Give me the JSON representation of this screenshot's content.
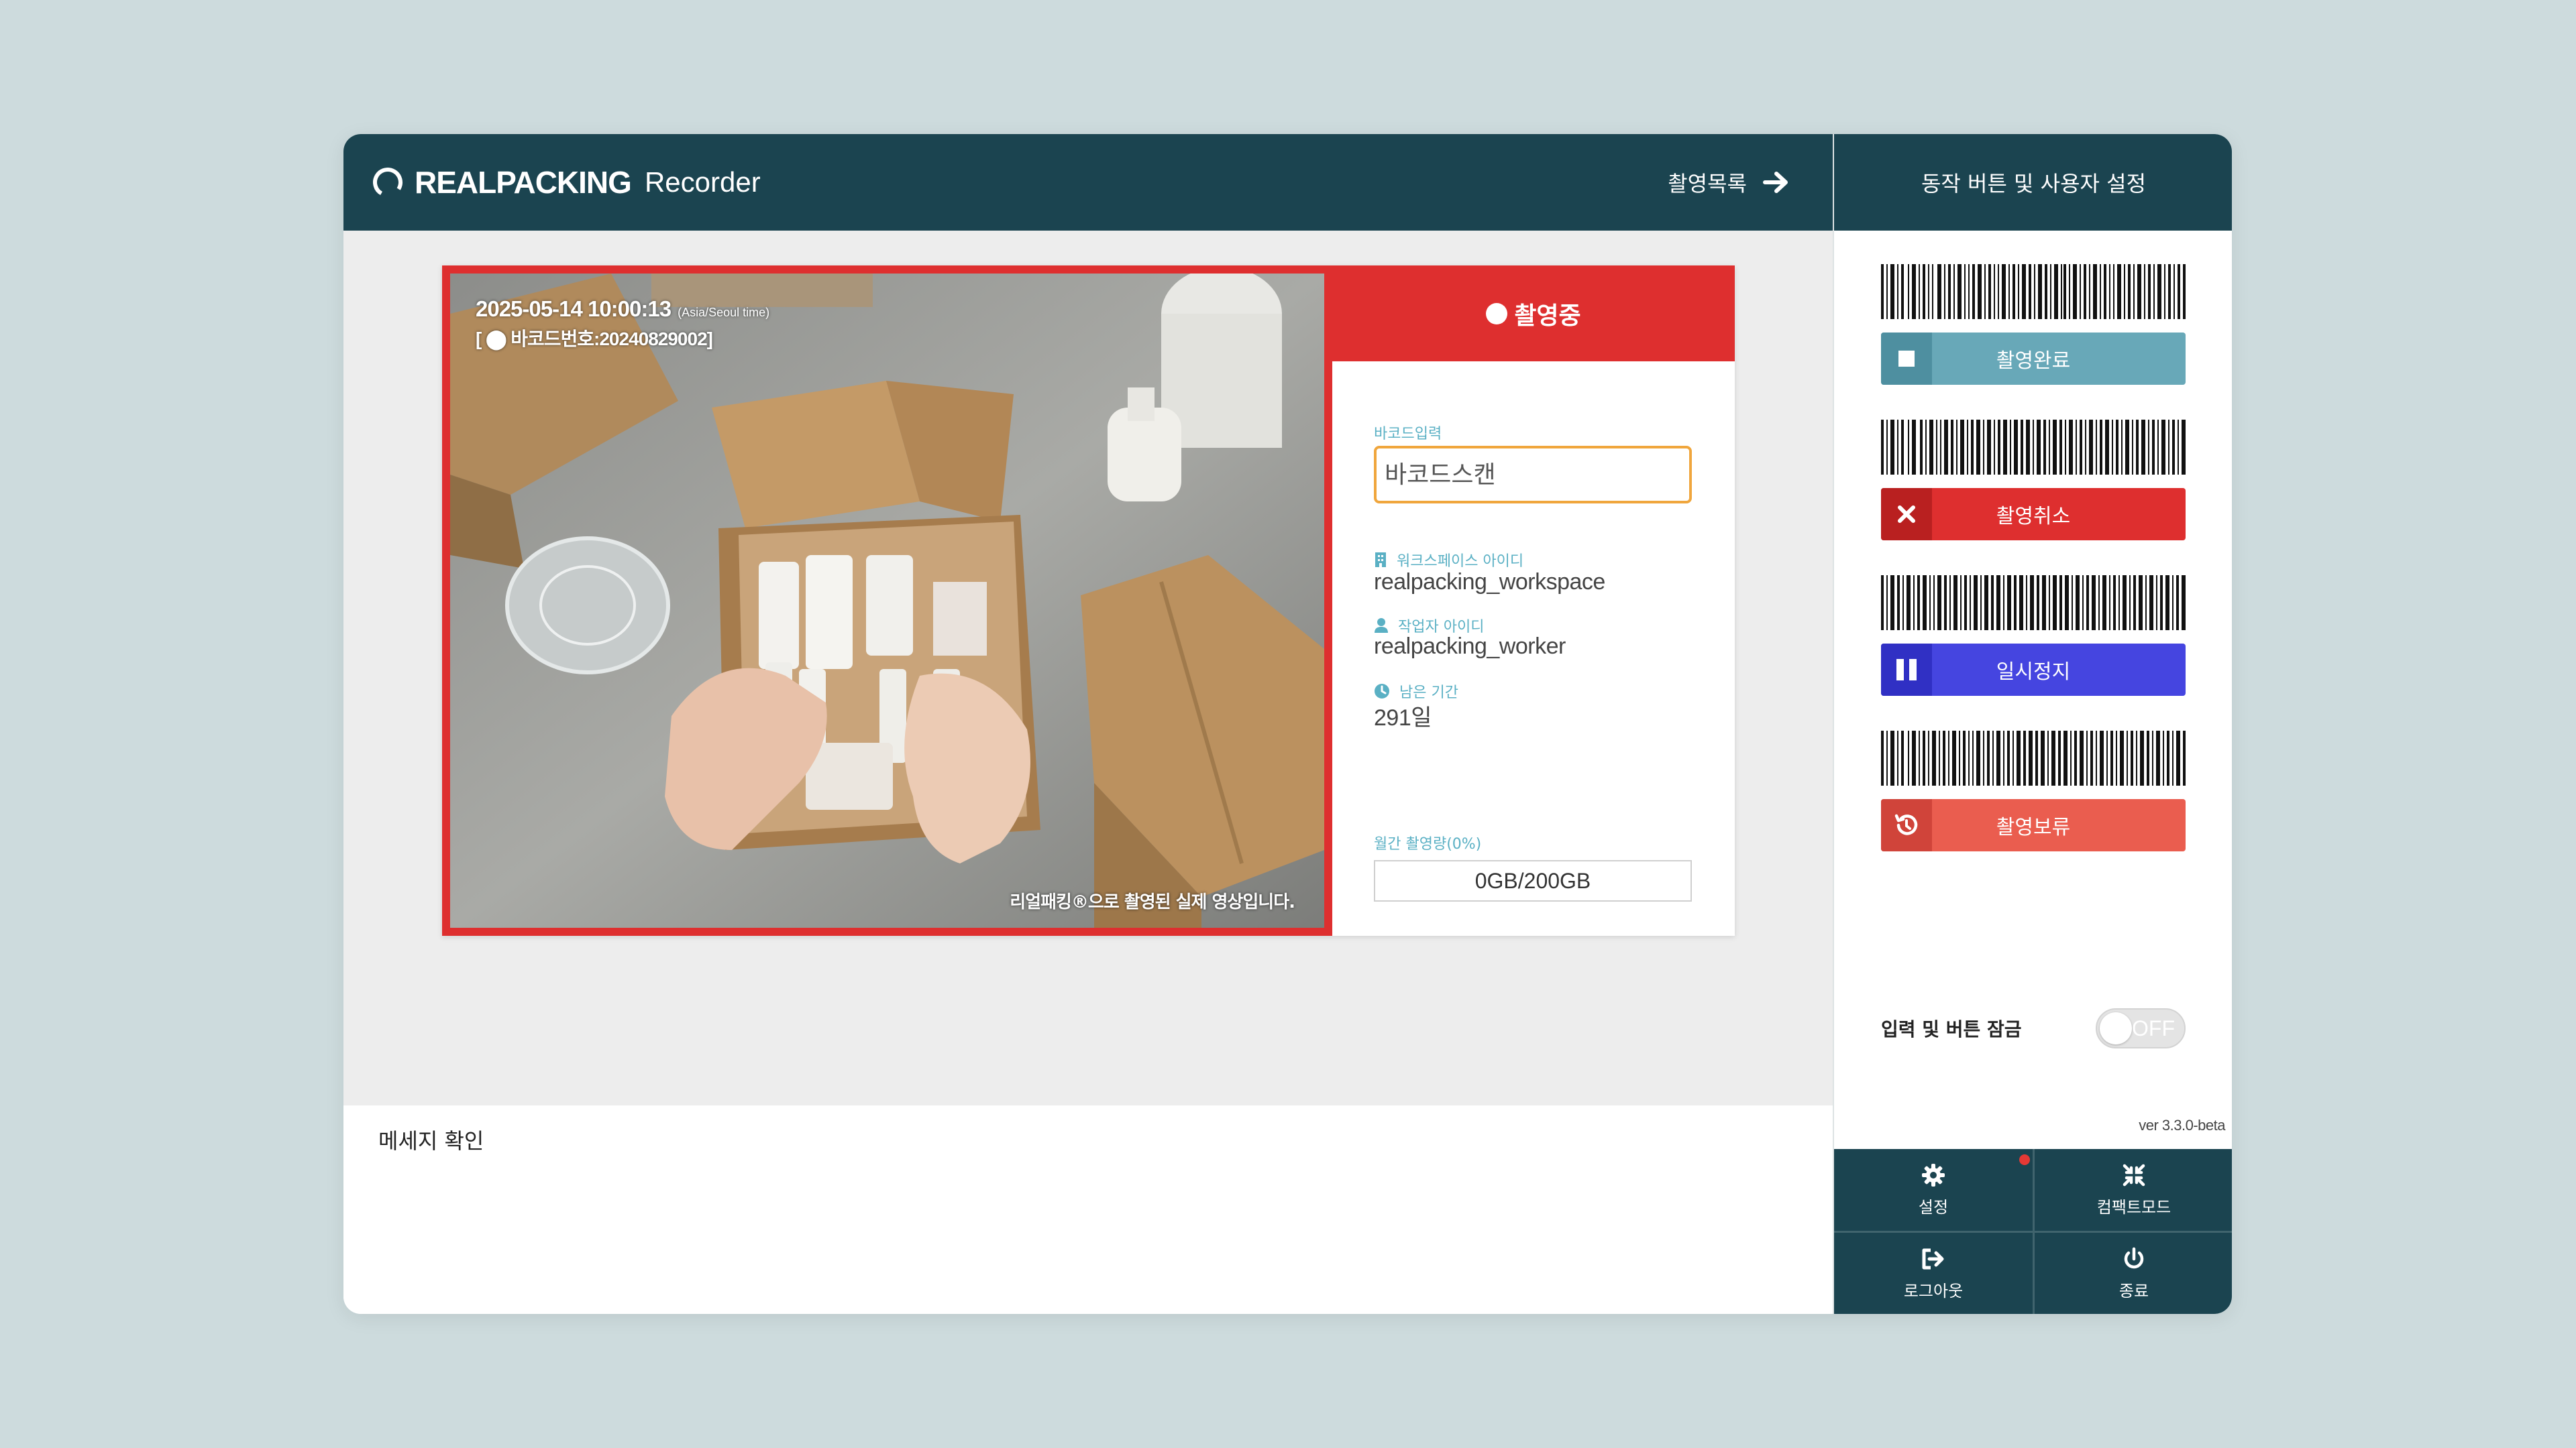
{
  "header": {
    "brand": "REALPACKING",
    "app_name": "Recorder",
    "history_link": "촬영목록"
  },
  "video": {
    "datetime": "2025-05-14 10:00:13",
    "timezone": "(Asia/Seoul time)",
    "barcode_overlay": "[ ⬤ 바코드번호:20240829002]",
    "caption": "리얼패킹®으로 촬영된 실제 영상입니다."
  },
  "status": {
    "recording_label": "촬영중",
    "color": "#de2f2f"
  },
  "info": {
    "barcode_input_label": "바코드입력",
    "barcode_input_placeholder": "바코드스캔",
    "workspace_label": "워크스페이스 아이디",
    "workspace_value": "realpacking_workspace",
    "worker_label": "작업자 아이디",
    "worker_value": "realpacking_worker",
    "remaining_label": "남은 기간",
    "remaining_value": "291일",
    "usage_label": "월간 촬영량(0%)",
    "usage_value": "0GB/200GB"
  },
  "messages": {
    "title": "메세지 확인"
  },
  "sidebar": {
    "title": "동작 버튼 및 사용자 설정",
    "actions": [
      {
        "label": "촬영완료",
        "color": "#68a8b8",
        "icon": "stop-icon"
      },
      {
        "label": "촬영취소",
        "color": "#de2f2f",
        "icon": "close-icon"
      },
      {
        "label": "일시정지",
        "color": "#4545e0",
        "icon": "pause-icon"
      },
      {
        "label": "촬영보류",
        "color": "#ea5d4f",
        "icon": "history-icon"
      }
    ],
    "lock_label": "입력 및 버튼 잠금",
    "lock_state": "OFF",
    "version": "ver 3.3.0-beta",
    "grid": [
      {
        "label": "설정",
        "icon": "gear-icon"
      },
      {
        "label": "컴팩트모드",
        "icon": "compress-icon"
      },
      {
        "label": "로그아웃",
        "icon": "logout-icon"
      },
      {
        "label": "종료",
        "icon": "power-icon"
      }
    ]
  },
  "colors": {
    "header_bg": "#1b4450",
    "page_bg": "#cddbdd",
    "accent_border": "#f0a63d",
    "label_blue": "#5ab0c4"
  }
}
